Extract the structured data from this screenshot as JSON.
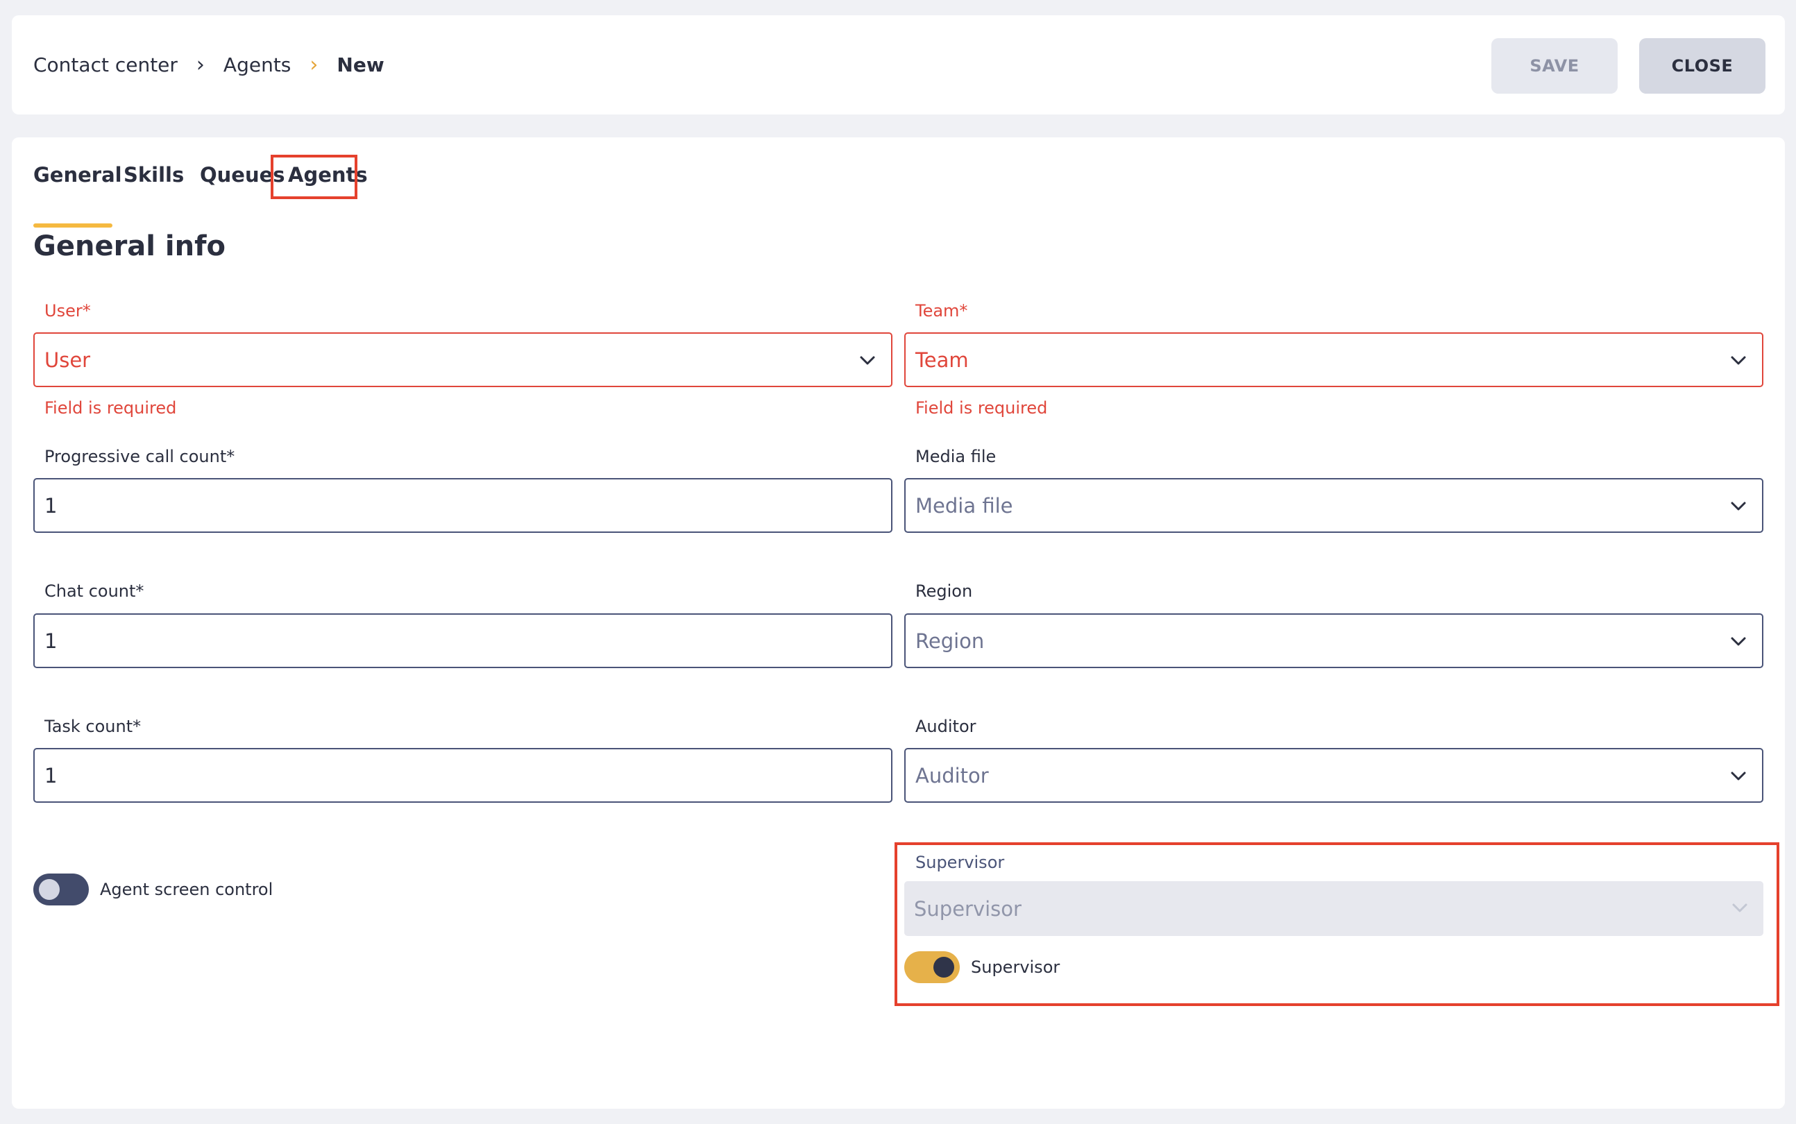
{
  "breadcrumb": {
    "items": [
      "Contact center",
      "Agents",
      "New"
    ]
  },
  "toolbar": {
    "save_label": "SAVE",
    "close_label": "CLOSE"
  },
  "tabs": [
    {
      "label": "General",
      "active": true
    },
    {
      "label": "Skills"
    },
    {
      "label": "Queues"
    },
    {
      "label": "Agents"
    }
  ],
  "section_title": "General info",
  "form": {
    "user": {
      "label": "User*",
      "placeholder": "User",
      "error": "Field is required"
    },
    "team": {
      "label": "Team*",
      "placeholder": "Team",
      "error": "Field is required"
    },
    "progressive_call_count": {
      "label": "Progressive call count*",
      "value": "1"
    },
    "media_file": {
      "label": "Media file",
      "placeholder": "Media file"
    },
    "chat_count": {
      "label": "Chat count*",
      "value": "1"
    },
    "region": {
      "label": "Region",
      "placeholder": "Region"
    },
    "task_count": {
      "label": "Task count*",
      "value": "1"
    },
    "auditor": {
      "label": "Auditor",
      "placeholder": "Auditor"
    },
    "agent_screen_control": {
      "label": "Agent screen control",
      "enabled": false
    },
    "supervisor_select": {
      "label": "Supervisor",
      "placeholder": "Supervisor",
      "disabled": true
    },
    "supervisor_toggle": {
      "label": "Supervisor",
      "enabled": true
    }
  },
  "colors": {
    "accent": "#f5b940",
    "error": "#e0463b",
    "highlight": "#e5412d",
    "toggle_on": "#e6b14a",
    "toggle_off": "#424b6b"
  }
}
